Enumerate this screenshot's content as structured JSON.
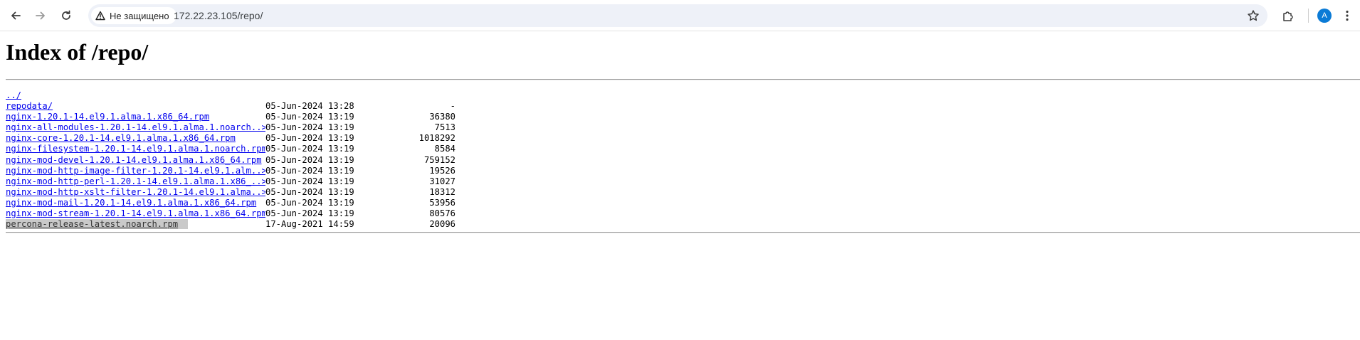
{
  "browser": {
    "security_label": "Не защищено",
    "url": "172.22.23.105/repo/",
    "profile_initial": "A",
    "icons": [
      "back-icon",
      "forward-icon",
      "reload-icon",
      "warning-icon",
      "star-icon",
      "extensions-icon",
      "more-icon"
    ]
  },
  "page": {
    "title": "Index of /repo/",
    "parent_link": "../",
    "entries": [
      {
        "name": "repodata/",
        "date": "05-Jun-2024 13:28",
        "size": "-"
      },
      {
        "name": "nginx-1.20.1-14.el9.1.alma.1.x86_64.rpm",
        "date": "05-Jun-2024 13:19",
        "size": "36380"
      },
      {
        "name": "nginx-all-modules-1.20.1-14.el9.1.alma.1.noarch..>",
        "date": "05-Jun-2024 13:19",
        "size": "7513"
      },
      {
        "name": "nginx-core-1.20.1-14.el9.1.alma.1.x86_64.rpm",
        "date": "05-Jun-2024 13:19",
        "size": "1018292"
      },
      {
        "name": "nginx-filesystem-1.20.1-14.el9.1.alma.1.noarch.rpm",
        "date": "05-Jun-2024 13:19",
        "size": "8584"
      },
      {
        "name": "nginx-mod-devel-1.20.1-14.el9.1.alma.1.x86_64.rpm",
        "date": "05-Jun-2024 13:19",
        "size": "759152"
      },
      {
        "name": "nginx-mod-http-image-filter-1.20.1-14.el9.1.alm..>",
        "date": "05-Jun-2024 13:19",
        "size": "19526"
      },
      {
        "name": "nginx-mod-http-perl-1.20.1-14.el9.1.alma.1.x86_..>",
        "date": "05-Jun-2024 13:19",
        "size": "31027"
      },
      {
        "name": "nginx-mod-http-xslt-filter-1.20.1-14.el9.1.alma..>",
        "date": "05-Jun-2024 13:19",
        "size": "18312"
      },
      {
        "name": "nginx-mod-mail-1.20.1-14.el9.1.alma.1.x86_64.rpm",
        "date": "05-Jun-2024 13:19",
        "size": "53956"
      },
      {
        "name": "nginx-mod-stream-1.20.1-14.el9.1.alma.1.x86_64.rpm",
        "date": "05-Jun-2024 13:19",
        "size": "80576"
      },
      {
        "name": "percona-release-latest.noarch.rpm",
        "date": "17-Aug-2021 14:59",
        "size": "20096",
        "highlighted": true
      }
    ]
  }
}
